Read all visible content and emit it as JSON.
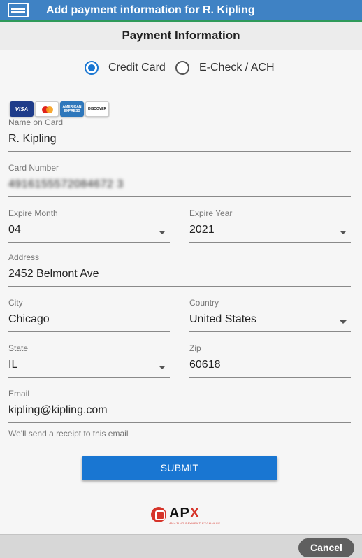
{
  "window": {
    "title": "Add payment information for R. Kipling"
  },
  "section": {
    "title": "Payment Information"
  },
  "payment_method": {
    "options": [
      {
        "label": "Credit Card",
        "selected": true
      },
      {
        "label": "E-Check / ACH",
        "selected": false
      }
    ]
  },
  "card_logos": [
    "VISA",
    "mastercard",
    "AMERICAN EXPRESS",
    "DISCOVER"
  ],
  "form": {
    "name_on_card": {
      "label": "Name on Card",
      "value": "R. Kipling"
    },
    "card_number": {
      "label": "Card Number",
      "value": "4916155572084672 3"
    },
    "expire_month": {
      "label": "Expire Month",
      "value": "04"
    },
    "expire_year": {
      "label": "Expire Year",
      "value": "2021"
    },
    "address": {
      "label": "Address",
      "value": "2452 Belmont Ave"
    },
    "city": {
      "label": "City",
      "value": "Chicago"
    },
    "country": {
      "label": "Country",
      "value": "United States"
    },
    "state": {
      "label": "State",
      "value": "IL"
    },
    "zip": {
      "label": "Zip",
      "value": "60618"
    },
    "email": {
      "label": "Email",
      "value": "kipling@kipling.com",
      "hint": "We'll send a receipt to this email"
    }
  },
  "actions": {
    "submit": "SUBMIT",
    "cancel": "Cancel"
  },
  "logo": {
    "text": "APX",
    "tagline": "AMAZING PAYMENT EXCHANGE"
  },
  "colors": {
    "header": "#3f82c4",
    "accent": "#1976d2",
    "cancel": "#5f5f5f"
  }
}
